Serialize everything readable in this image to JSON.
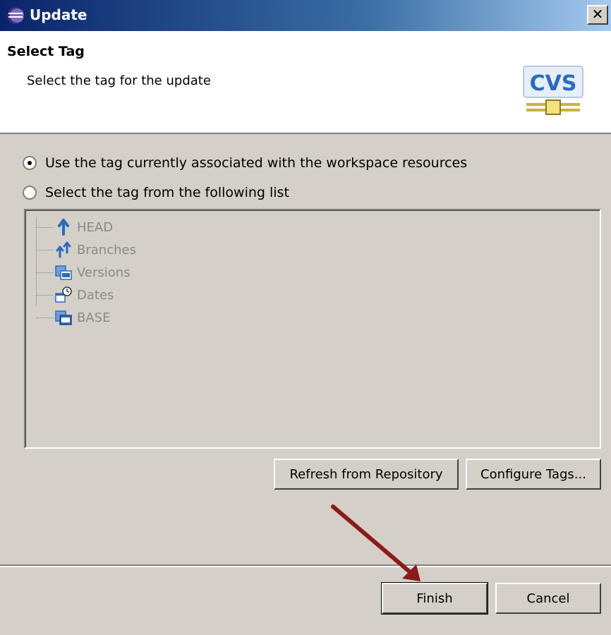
{
  "window": {
    "title": "Update",
    "close_label": "✕"
  },
  "header": {
    "title": "Select Tag",
    "description": "Select the tag for the update",
    "logo_text": "CVS"
  },
  "options": [
    {
      "label": "Use the tag currently associated with the workspace resources",
      "checked": true
    },
    {
      "label": "Select the tag from the following list",
      "checked": false
    }
  ],
  "tree": {
    "items": [
      {
        "label": "HEAD",
        "icon": "head-tag-icon"
      },
      {
        "label": "Branches",
        "icon": "branches-icon"
      },
      {
        "label": "Versions",
        "icon": "versions-icon"
      },
      {
        "label": "Dates",
        "icon": "dates-icon"
      },
      {
        "label": "BASE",
        "icon": "base-tag-icon"
      }
    ]
  },
  "buttons": {
    "refresh": "Refresh from Repository",
    "configure": "Configure Tags...",
    "finish": "Finish",
    "cancel": "Cancel"
  },
  "colors": {
    "titlebar": "#0a246a",
    "annotation_arrow": "#8b1a1a",
    "icon_blue": "#2a6bc0"
  }
}
